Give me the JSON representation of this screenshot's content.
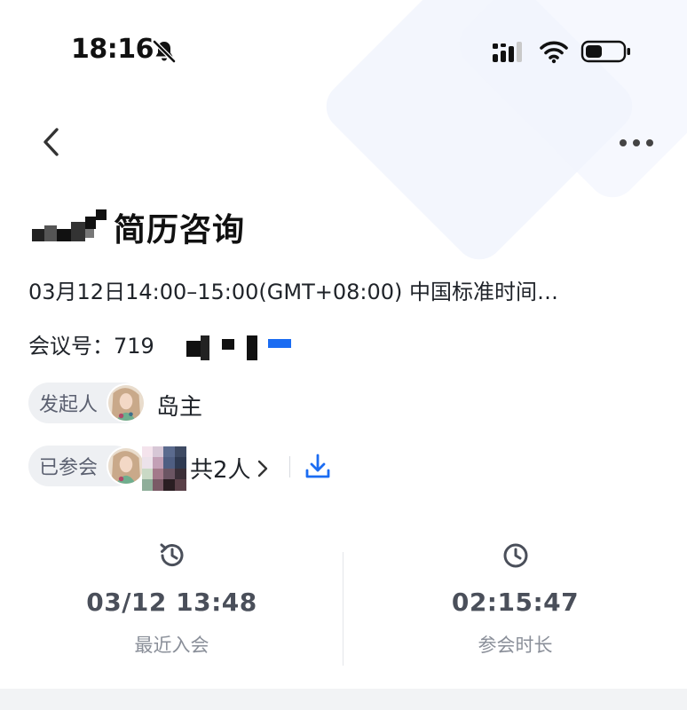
{
  "status_bar": {
    "time": "18:16",
    "icons": [
      "bell-muted-icon",
      "signal-icon",
      "wifi-icon",
      "battery-icon"
    ]
  },
  "nav": {
    "back_icon": "chevron-left-icon",
    "more_icon": "more-horizontal-icon"
  },
  "meeting": {
    "title": "简历咨询",
    "time_range": "03月12日14:00–15:00(GMT+08:00) 中国标准时间…",
    "id_label": "会议号：719"
  },
  "organizer": {
    "label": "发起人",
    "name": "岛主"
  },
  "participants": {
    "label": "已参会",
    "count_text": "共2人",
    "download_icon": "download-icon"
  },
  "stats": {
    "last_join": {
      "value": "03/12 13:48",
      "label": "最近入会",
      "icon": "history-icon"
    },
    "duration": {
      "value": "02:15:47",
      "label": "参会时长",
      "icon": "clock-icon"
    }
  },
  "colors": {
    "accent": "#1b6cf2",
    "pill_bg": "#eef0f3",
    "muted_text": "#8a8f99",
    "stat_value": "#4a4f5a",
    "bg_shape": "#f1f5fd"
  }
}
